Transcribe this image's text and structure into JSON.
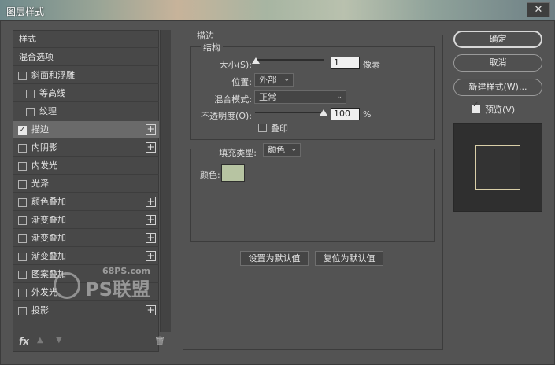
{
  "window": {
    "title": "图层样式",
    "close_glyph": "✕"
  },
  "styles_list": {
    "header": "样式",
    "blend_options": "混合选项",
    "items": [
      {
        "label": "斜面和浮雕",
        "checked": false,
        "has_plus": false,
        "indent": false
      },
      {
        "label": "等高线",
        "checked": false,
        "has_plus": false,
        "indent": true
      },
      {
        "label": "纹理",
        "checked": false,
        "has_plus": false,
        "indent": true
      },
      {
        "label": "描边",
        "checked": true,
        "has_plus": true,
        "indent": false,
        "selected": true
      },
      {
        "label": "内阴影",
        "checked": false,
        "has_plus": true,
        "indent": false
      },
      {
        "label": "内发光",
        "checked": false,
        "has_plus": false,
        "indent": false
      },
      {
        "label": "光泽",
        "checked": false,
        "has_plus": false,
        "indent": false
      },
      {
        "label": "颜色叠加",
        "checked": false,
        "has_plus": true,
        "indent": false
      },
      {
        "label": "渐变叠加",
        "checked": false,
        "has_plus": true,
        "indent": false
      },
      {
        "label": "渐变叠加",
        "checked": false,
        "has_plus": true,
        "indent": false
      },
      {
        "label": "渐变叠加",
        "checked": false,
        "has_plus": true,
        "indent": false
      },
      {
        "label": "图案叠加",
        "checked": false,
        "has_plus": false,
        "indent": false
      },
      {
        "label": "外发光",
        "checked": false,
        "has_plus": false,
        "indent": false
      },
      {
        "label": "投影",
        "checked": false,
        "has_plus": true,
        "indent": false
      }
    ],
    "plus_glyph": "+",
    "footer": {
      "fx": "fx",
      "up_glyph": "▲",
      "down_glyph": "▼",
      "trash_glyph": "🗑"
    }
  },
  "stroke": {
    "group_title": "描边",
    "structure_title": "结构",
    "size_label": "大小(S):",
    "size_value": "1",
    "size_unit": "像素",
    "size_level": 0.01,
    "position_label": "位置:",
    "position_value": "外部",
    "blend_mode_label": "混合模式:",
    "blend_mode_value": "正常",
    "opacity_label": "不透明度(O):",
    "opacity_value": "100",
    "opacity_unit": "%",
    "opacity_level": 1.0,
    "overprint_label": "叠印",
    "fill_type_label": "填充类型:",
    "fill_type_value": "颜色",
    "color_label": "颜色:",
    "color_value": "#b7c4a2",
    "set_default_button": "设置为默认值",
    "reset_default_button": "复位为默认值"
  },
  "actions": {
    "ok": "确定",
    "cancel": "取消",
    "new_style": "新建样式(W)...",
    "preview_label": "预览(V)",
    "preview_checked": true
  },
  "watermark": {
    "url": "68PS.com",
    "text": "PS联盟"
  }
}
